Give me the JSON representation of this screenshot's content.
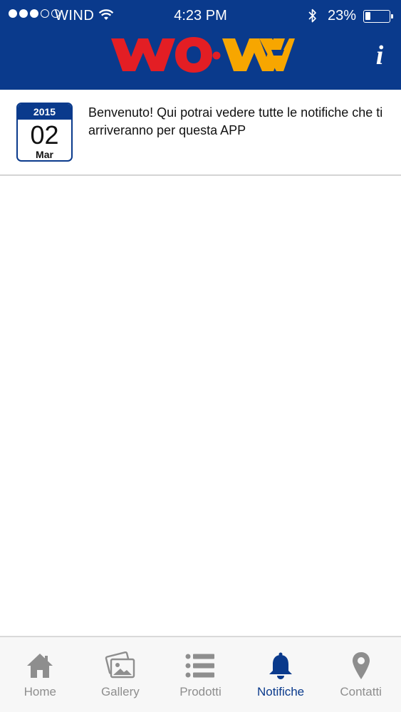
{
  "status_bar": {
    "carrier": "WIND",
    "time": "4:23 PM",
    "battery_percent": "23%",
    "battery_level": 0.23
  },
  "header": {
    "logo_text": "WO•WA",
    "info_label": "i",
    "colors": {
      "background": "#0a3a8c",
      "logo_left": "#e31e24",
      "logo_right": "#f7a600"
    }
  },
  "notifications": [
    {
      "year": "2015",
      "day": "02",
      "month": "Mar",
      "message": "Benvenuto! Qui potrai vedere tutte le notifiche che ti arriveranno per questa APP"
    }
  ],
  "tabbar": {
    "active": "Notifiche",
    "tabs": [
      {
        "label": "Home",
        "icon": "home-icon"
      },
      {
        "label": "Gallery",
        "icon": "gallery-icon"
      },
      {
        "label": "Prodotti",
        "icon": "list-icon"
      },
      {
        "label": "Notifiche",
        "icon": "bell-icon"
      },
      {
        "label": "Contatti",
        "icon": "location-pin-icon"
      }
    ]
  }
}
